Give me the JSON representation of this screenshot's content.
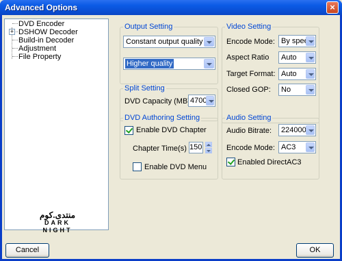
{
  "window": {
    "title": "Advanced Options",
    "close_glyph": "×"
  },
  "tree": {
    "items": [
      {
        "label": "DVD Encoder"
      },
      {
        "label": "DSHOW Decoder",
        "expander": "+"
      },
      {
        "label": "Build-in Decoder"
      },
      {
        "label": "Adjustment"
      },
      {
        "label": "File Property"
      }
    ],
    "logo": {
      "arabic": "منتدى.كوم",
      "english": "DARK NIGHT"
    }
  },
  "output_setting": {
    "title": "Output Setting",
    "quality_mode": "Constant output quality",
    "quality_level": "Higher quality"
  },
  "split_setting": {
    "title": "Split Setting",
    "capacity_label": "DVD Capacity (MB):",
    "capacity_value": "4700"
  },
  "dvd_authoring": {
    "title": "DVD Authoring Setting",
    "enable_chapter_label": "Enable DVD Chapter",
    "enable_chapter_checked": true,
    "chapter_time_label": "Chapter Time(s)",
    "chapter_time_value": "150",
    "enable_menu_label": "Enable DVD Menu",
    "enable_menu_checked": false
  },
  "video_setting": {
    "title": "Video Setting",
    "fields": [
      {
        "label": "Encode Mode:",
        "value": "By speed"
      },
      {
        "label": "Aspect Ratio",
        "value": "Auto"
      },
      {
        "label": "Target Format:",
        "value": "Auto"
      },
      {
        "label": "Closed GOP:",
        "value": "No"
      }
    ]
  },
  "audio_setting": {
    "title": "Audio Setting",
    "bitrate_label": "Audio Bitrate:",
    "bitrate_value": "224000",
    "encode_mode_label": "Encode Mode:",
    "encode_mode_value": "AC3",
    "direct_ac3_label": "Enabled DirectAC3",
    "direct_ac3_checked": true
  },
  "buttons": {
    "cancel": "Cancel",
    "ok": "OK"
  }
}
